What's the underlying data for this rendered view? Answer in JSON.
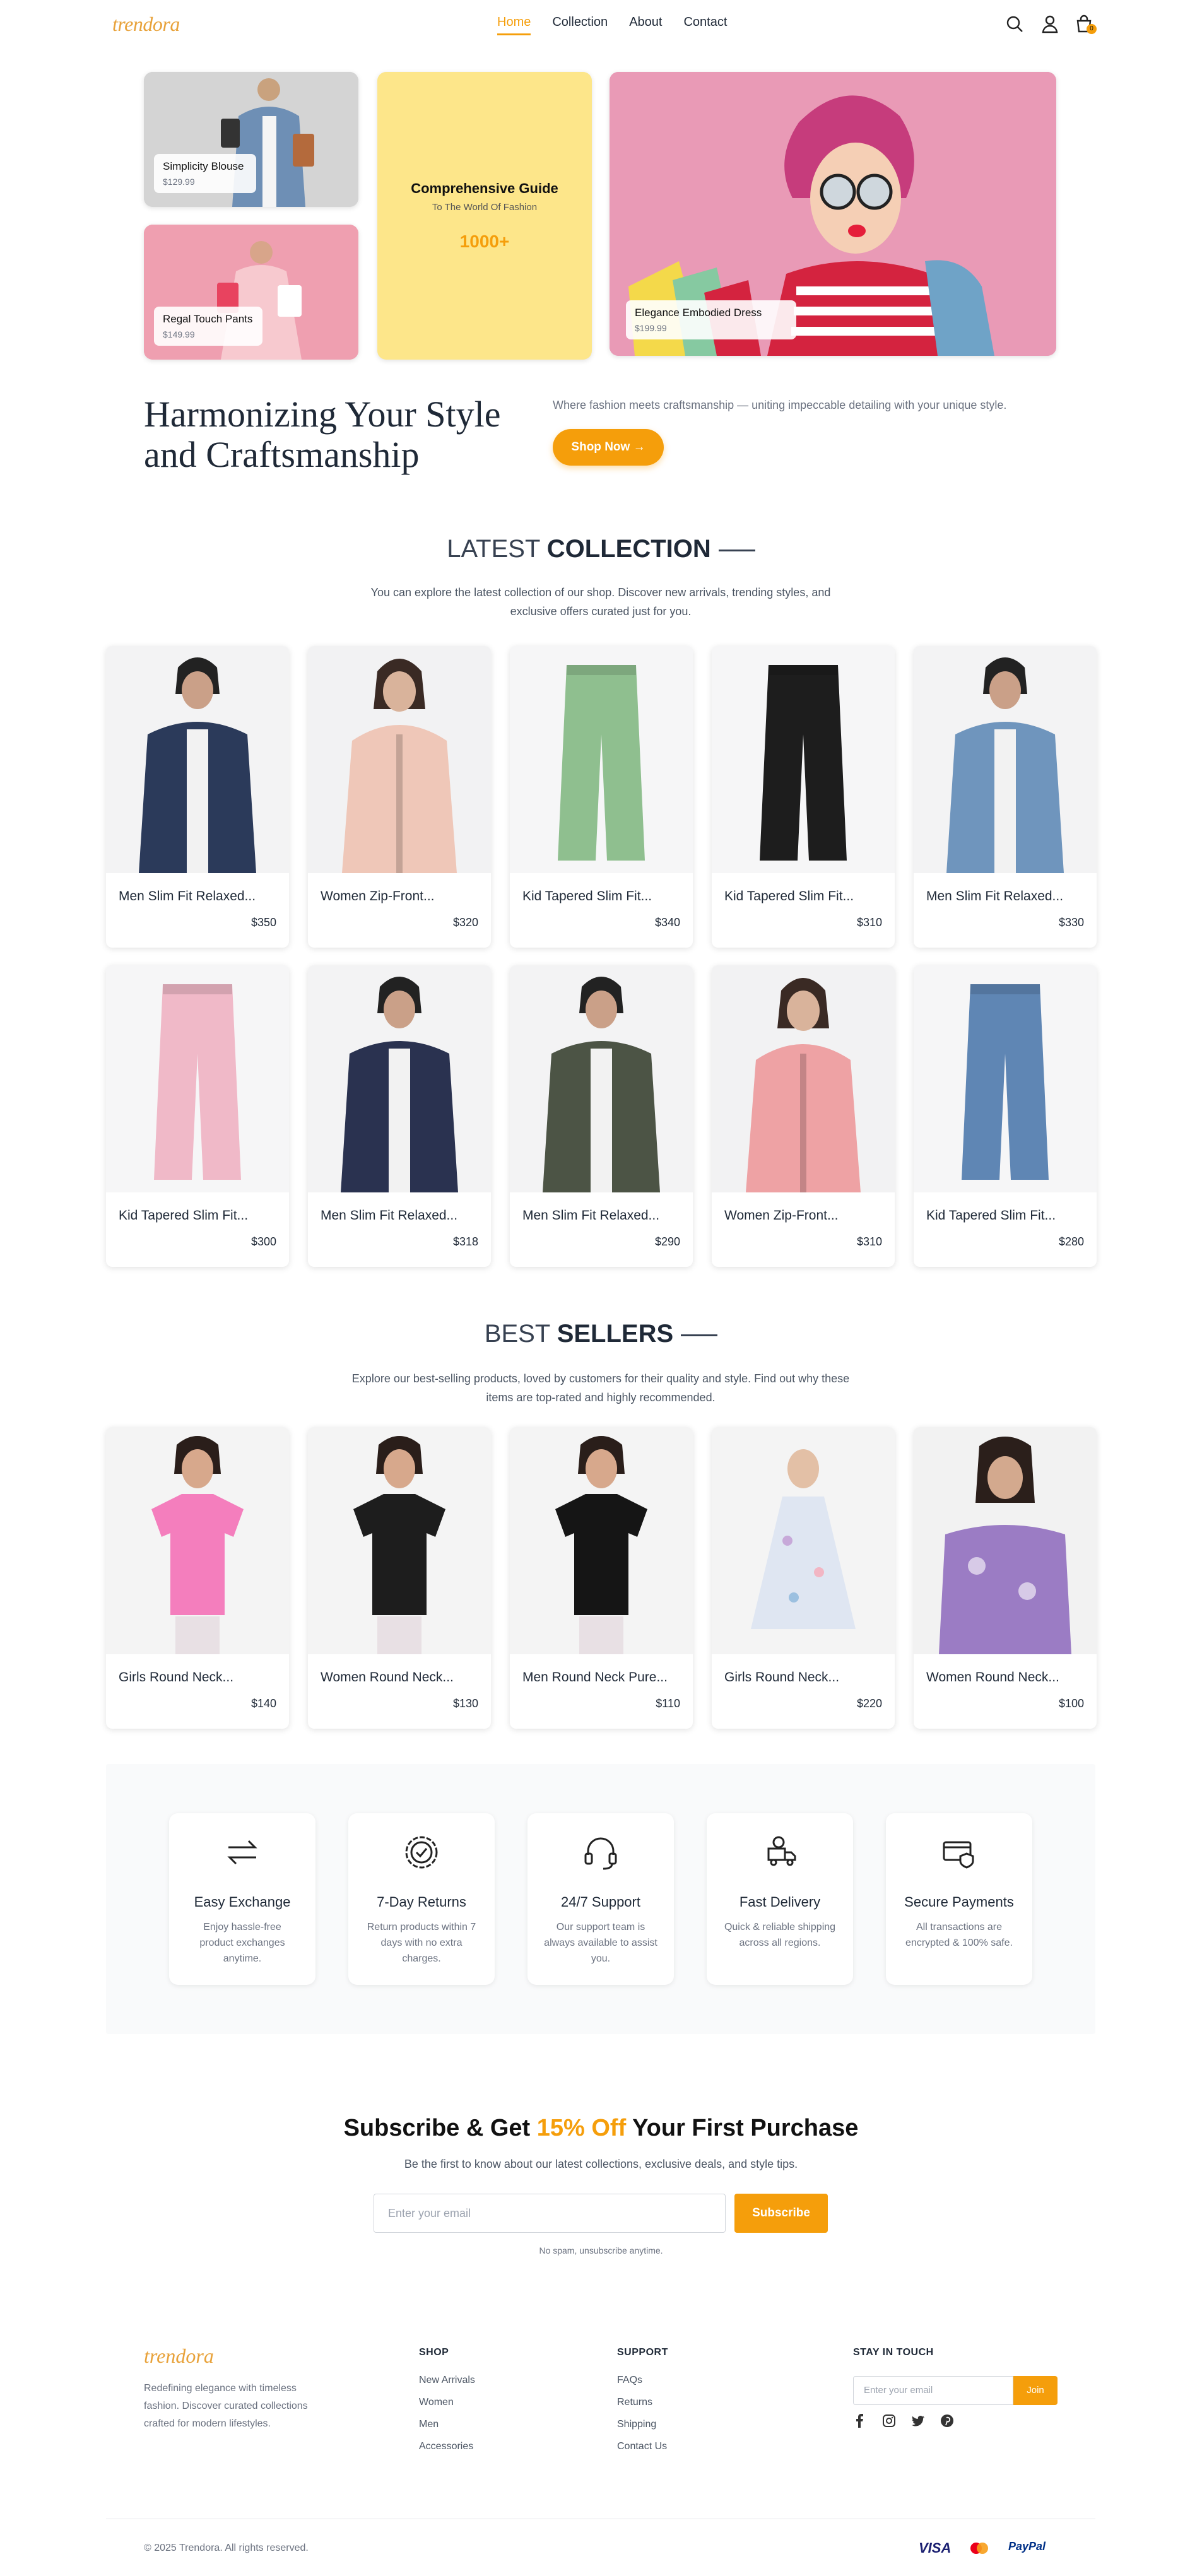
{
  "nav": {
    "logo": "trendora",
    "links": [
      {
        "label": "Home",
        "active": true
      },
      {
        "label": "Collection",
        "active": false
      },
      {
        "label": "About",
        "active": false
      },
      {
        "label": "Contact",
        "active": false
      }
    ],
    "icons": [
      "search-icon",
      "user-icon",
      "cart-icon"
    ],
    "cart_count": "0"
  },
  "hero": {
    "cards": [
      {
        "name": "Simplicity Blouse",
        "price": "$129.99"
      },
      {
        "name": "Regal Touch Pants",
        "price": "$149.99"
      },
      {
        "name": "Elegance Embodied Dress",
        "price": "$199.99"
      }
    ],
    "guide": {
      "title": "Comprehensive Guide",
      "subtitle": "To The World Of Fashion",
      "count": "1000+"
    },
    "title": "Harmonizing Your Style and Craftsmanship",
    "subtitle": "Where fashion meets craftsmanship — uniting impeccable detailing with your unique style.",
    "cta": "Shop Now →"
  },
  "latest": {
    "title_light": "LATEST",
    "title_bold": "COLLECTION",
    "description": "You can explore the latest collection of our shop. Discover new arrivals, trending styles, and exclusive offers curated just for you.",
    "products": [
      {
        "name": "Men Slim Fit Relaxed...",
        "price": "$350"
      },
      {
        "name": "Women Zip-Front...",
        "price": "$320"
      },
      {
        "name": "Kid Tapered Slim Fit...",
        "price": "$340"
      },
      {
        "name": "Kid Tapered Slim Fit...",
        "price": "$310"
      },
      {
        "name": "Men Slim Fit Relaxed...",
        "price": "$330"
      },
      {
        "name": "Kid Tapered Slim Fit...",
        "price": "$300"
      },
      {
        "name": "Men Slim Fit Relaxed...",
        "price": "$318"
      },
      {
        "name": "Men Slim Fit Relaxed...",
        "price": "$290"
      },
      {
        "name": "Women Zip-Front...",
        "price": "$310"
      },
      {
        "name": "Kid Tapered Slim Fit...",
        "price": "$280"
      }
    ]
  },
  "best": {
    "title_light": "BEST",
    "title_bold": "SELLERS",
    "description": "Explore our best-selling products, loved by customers for their quality and style. Find out why these items are top-rated and highly recommended.",
    "products": [
      {
        "name": "Girls Round Neck...",
        "price": "$140"
      },
      {
        "name": "Women Round Neck...",
        "price": "$130"
      },
      {
        "name": "Men Round Neck Pure...",
        "price": "$110"
      },
      {
        "name": "Girls Round Neck...",
        "price": "$220"
      },
      {
        "name": "Women Round Neck...",
        "price": "$100"
      }
    ]
  },
  "features": [
    {
      "icon": "exchange-icon",
      "title": "Easy Exchange",
      "desc": "Enjoy hassle-free product exchanges anytime."
    },
    {
      "icon": "badge-check-icon",
      "title": "7-Day Returns",
      "desc": "Return products within 7 days with no extra charges."
    },
    {
      "icon": "headset-icon",
      "title": "24/7 Support",
      "desc": "Our support team is always available to assist you."
    },
    {
      "icon": "delivery-truck-icon",
      "title": "Fast Delivery",
      "desc": "Quick & reliable shipping across all regions."
    },
    {
      "icon": "secure-card-icon",
      "title": "Secure Payments",
      "desc": "All transactions are encrypted & 100% safe."
    }
  ],
  "subscribe": {
    "title_a": "Subscribe & Get ",
    "title_b": "15% Off",
    "title_c": " Your First Purchase",
    "subtitle": "Be the first to know about our latest collections, exclusive deals, and style tips.",
    "placeholder": "Enter your email",
    "button": "Subscribe",
    "note": "No spam, unsubscribe anytime."
  },
  "footer": {
    "logo": "trendora",
    "description": "Redefining elegance with timeless fashion. Discover curated collections crafted for modern lifestyles.",
    "shop_title": "SHOP",
    "shop_links": [
      "New Arrivals",
      "Women",
      "Men",
      "Accessories"
    ],
    "support_title": "SUPPORT",
    "support_links": [
      "FAQs",
      "Returns",
      "Shipping",
      "Contact Us"
    ],
    "stay_title": "STAY IN TOUCH",
    "placeholder": "Enter your email",
    "join": "Join",
    "social": [
      "facebook-icon",
      "instagram-icon",
      "twitter-icon",
      "pinterest-icon"
    ],
    "copyright": "© 2025 Trendora. All rights reserved.",
    "payments": [
      "VISA",
      "mastercard",
      "PayPal"
    ]
  },
  "colors": {
    "accent": "#f59e0b",
    "guide_bg": "#fde68a",
    "text": "#1f2937",
    "muted": "#6b7280"
  }
}
